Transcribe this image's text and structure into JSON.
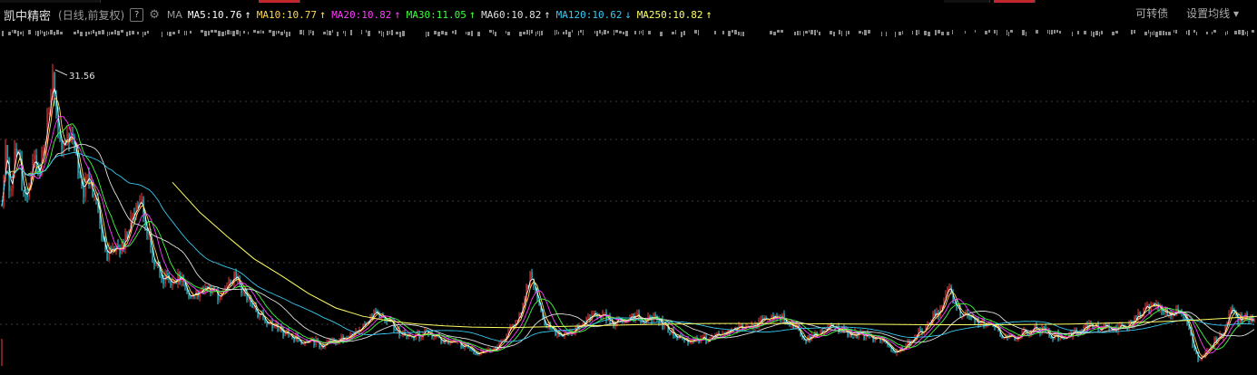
{
  "header": {
    "stock_name": "凯中精密",
    "period_label": "(日线,前复权)",
    "help_label": "?",
    "ma_label": "MA",
    "right_tools": {
      "convertible": "可转债",
      "ma_settings": "设置均线"
    },
    "ma_items": [
      {
        "text": "MA5:10.76",
        "color": "#ffffff",
        "arrow": "↑"
      },
      {
        "text": "MA10:10.77",
        "color": "#ffd84a",
        "arrow": "↑"
      },
      {
        "text": "MA20:10.82",
        "color": "#ff3cff",
        "arrow": "↑"
      },
      {
        "text": "MA30:11.05",
        "color": "#3cff3c",
        "arrow": "↑"
      },
      {
        "text": "MA60:10.82",
        "color": "#e0e0e0",
        "arrow": "↑"
      },
      {
        "text": "MA120:10.62",
        "color": "#38c8f0",
        "arrow": "↓"
      },
      {
        "text": "MA250:10.82",
        "color": "#ffff66",
        "arrow": "↑"
      }
    ]
  },
  "colors": {
    "up": "#ff3c3c",
    "down": "#35e0f0",
    "ma5": "#ffffff",
    "ma10": "#ffd84a",
    "ma20": "#ff3cff",
    "ma30": "#3cff3c",
    "ma60": "#e0e0e0",
    "ma120": "#38c8f0",
    "ma250": "#ffff66"
  },
  "chart_data": {
    "type": "line",
    "title": "凯中精密",
    "ylim": [
      6.5,
      33
    ],
    "annotations": [
      {
        "text": "31.56",
        "x": 58,
        "y": 31.56
      }
    ],
    "price_anchors": [
      [
        0,
        17.5
      ],
      [
        3,
        22.0
      ],
      [
        6,
        25.5
      ],
      [
        10,
        21.0
      ],
      [
        16,
        24.5
      ],
      [
        22,
        23.5
      ],
      [
        27,
        20.0
      ],
      [
        32,
        21.5
      ],
      [
        38,
        24.0
      ],
      [
        44,
        23.0
      ],
      [
        50,
        26.0
      ],
      [
        55,
        28.0
      ],
      [
        58,
        31.56
      ],
      [
        62,
        27.0
      ],
      [
        68,
        24.5
      ],
      [
        74,
        26.5
      ],
      [
        80,
        25.0
      ],
      [
        86,
        23.0
      ],
      [
        92,
        21.5
      ],
      [
        98,
        22.5
      ],
      [
        106,
        20.0
      ],
      [
        112,
        17.8
      ],
      [
        118,
        16.0
      ],
      [
        124,
        16.8
      ],
      [
        130,
        16.2
      ],
      [
        140,
        17.5
      ],
      [
        148,
        19.5
      ],
      [
        155,
        20.5
      ],
      [
        162,
        18.0
      ],
      [
        170,
        15.5
      ],
      [
        180,
        14.0
      ],
      [
        190,
        13.8
      ],
      [
        200,
        14.2
      ],
      [
        210,
        12.2
      ],
      [
        220,
        12.8
      ],
      [
        230,
        13.0
      ],
      [
        240,
        12.5
      ],
      [
        250,
        13.3
      ],
      [
        258,
        14.2
      ],
      [
        265,
        13.2
      ],
      [
        275,
        12.0
      ],
      [
        285,
        11.0
      ],
      [
        295,
        10.4
      ],
      [
        305,
        9.9
      ],
      [
        315,
        9.3
      ],
      [
        325,
        9.0
      ],
      [
        335,
        8.6
      ],
      [
        345,
        8.7
      ],
      [
        355,
        8.4
      ],
      [
        365,
        8.8
      ],
      [
        375,
        8.9
      ],
      [
        385,
        9.0
      ],
      [
        395,
        9.8
      ],
      [
        405,
        10.5
      ],
      [
        412,
        11.2
      ],
      [
        420,
        11.0
      ],
      [
        430,
        10.2
      ],
      [
        440,
        9.4
      ],
      [
        450,
        8.9
      ],
      [
        460,
        9.2
      ],
      [
        470,
        9.5
      ],
      [
        480,
        9.0
      ],
      [
        490,
        8.6
      ],
      [
        500,
        8.7
      ],
      [
        510,
        8.4
      ],
      [
        520,
        8.0
      ],
      [
        530,
        7.7
      ],
      [
        540,
        7.9
      ],
      [
        550,
        8.3
      ],
      [
        560,
        9.6
      ],
      [
        570,
        10.2
      ],
      [
        578,
        12.5
      ],
      [
        585,
        14.5
      ],
      [
        590,
        12.5
      ],
      [
        598,
        10.5
      ],
      [
        608,
        9.8
      ],
      [
        618,
        9.2
      ],
      [
        630,
        9.6
      ],
      [
        645,
        10.3
      ],
      [
        655,
        11.2
      ],
      [
        665,
        10.8
      ],
      [
        675,
        10.2
      ],
      [
        688,
        10.5
      ],
      [
        700,
        10.8
      ],
      [
        712,
        10.5
      ],
      [
        722,
        10.8
      ],
      [
        730,
        10.1
      ],
      [
        740,
        9.5
      ],
      [
        750,
        9.0
      ],
      [
        760,
        8.7
      ],
      [
        770,
        8.8
      ],
      [
        780,
        8.9
      ],
      [
        790,
        9.1
      ],
      [
        800,
        9.4
      ],
      [
        812,
        9.8
      ],
      [
        825,
        9.9
      ],
      [
        838,
        10.4
      ],
      [
        848,
        10.8
      ],
      [
        858,
        10.9
      ],
      [
        868,
        10.4
      ],
      [
        878,
        9.8
      ],
      [
        888,
        8.8
      ],
      [
        898,
        9.3
      ],
      [
        908,
        9.6
      ],
      [
        918,
        9.9
      ],
      [
        928,
        9.7
      ],
      [
        938,
        9.2
      ],
      [
        948,
        9.3
      ],
      [
        958,
        9.0
      ],
      [
        968,
        8.8
      ],
      [
        978,
        8.4
      ],
      [
        988,
        7.8
      ],
      [
        998,
        8.4
      ],
      [
        1008,
        9.1
      ],
      [
        1018,
        9.8
      ],
      [
        1026,
        10.6
      ],
      [
        1034,
        11.2
      ],
      [
        1040,
        12.0
      ],
      [
        1046,
        13.2
      ],
      [
        1052,
        11.8
      ],
      [
        1060,
        10.8
      ],
      [
        1070,
        10.6
      ],
      [
        1080,
        10.3
      ],
      [
        1090,
        10.0
      ],
      [
        1100,
        9.5
      ],
      [
        1110,
        9.0
      ],
      [
        1120,
        9.1
      ],
      [
        1130,
        9.5
      ],
      [
        1140,
        9.8
      ],
      [
        1150,
        9.6
      ],
      [
        1160,
        9.2
      ],
      [
        1170,
        9.0
      ],
      [
        1180,
        9.3
      ],
      [
        1190,
        9.7
      ],
      [
        1200,
        10.0
      ],
      [
        1212,
        9.8
      ],
      [
        1225,
        9.7
      ],
      [
        1240,
        9.9
      ],
      [
        1250,
        10.5
      ],
      [
        1260,
        11.3
      ],
      [
        1270,
        11.7
      ],
      [
        1280,
        11.3
      ],
      [
        1290,
        11.0
      ],
      [
        1300,
        11.2
      ],
      [
        1308,
        10.3
      ],
      [
        1314,
        8.4
      ],
      [
        1320,
        7.2
      ],
      [
        1326,
        7.6
      ],
      [
        1332,
        8.3
      ],
      [
        1340,
        8.9
      ],
      [
        1348,
        9.4
      ],
      [
        1356,
        11.3
      ],
      [
        1364,
        10.5
      ],
      [
        1372,
        10.8
      ],
      [
        1380,
        10.6
      ]
    ],
    "ma250_anchors": [
      [
        190,
        22.0
      ],
      [
        220,
        19.5
      ],
      [
        250,
        17.5
      ],
      [
        280,
        15.6
      ],
      [
        310,
        14.2
      ],
      [
        340,
        12.7
      ],
      [
        370,
        11.5
      ],
      [
        400,
        10.8
      ],
      [
        430,
        10.4
      ],
      [
        460,
        10.15
      ],
      [
        490,
        10.0
      ],
      [
        520,
        9.9
      ],
      [
        560,
        9.85
      ],
      [
        620,
        9.95
      ],
      [
        700,
        10.1
      ],
      [
        780,
        10.2
      ],
      [
        860,
        10.2
      ],
      [
        940,
        10.15
      ],
      [
        1020,
        10.1
      ],
      [
        1100,
        10.1
      ],
      [
        1180,
        10.15
      ],
      [
        1260,
        10.3
      ],
      [
        1320,
        10.5
      ],
      [
        1385,
        10.8
      ]
    ]
  }
}
